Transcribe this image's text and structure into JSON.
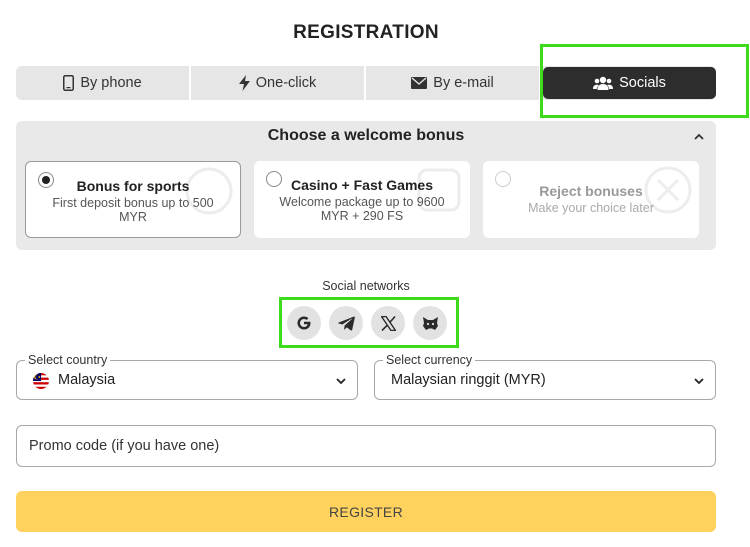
{
  "page": {
    "title": "REGISTRATION"
  },
  "tabs": [
    {
      "label": "By phone",
      "icon": "phone-icon",
      "active": false
    },
    {
      "label": "One-click",
      "icon": "lightning-icon",
      "active": false
    },
    {
      "label": "By e-mail",
      "icon": "envelope-icon",
      "active": false
    },
    {
      "label": "Socials",
      "icon": "users-icon",
      "active": true
    }
  ],
  "bonus": {
    "title": "Choose a welcome bonus",
    "options": [
      {
        "title": "Bonus for sports",
        "desc": "First deposit bonus up to 500 MYR",
        "selected": true
      },
      {
        "title": "Casino + Fast Games",
        "desc": "Welcome package up to 9600 MYR + 290 FS",
        "selected": false
      },
      {
        "title": "Reject bonuses",
        "desc": "Make your choice later",
        "selected": false
      }
    ]
  },
  "social": {
    "label": "Social networks",
    "networks": [
      "google-icon",
      "telegram-icon",
      "x-icon",
      "metamask-icon"
    ]
  },
  "country": {
    "label": "Select country",
    "value": "Malaysia"
  },
  "currency": {
    "label": "Select currency",
    "value": "Malaysian ringgit (MYR)"
  },
  "promo": {
    "placeholder": "Promo code (if you have one)"
  },
  "register": {
    "label": "REGISTER"
  },
  "colors": {
    "accent_button": "#ffd25e",
    "active_tab": "#2d2d2d",
    "highlight": "#3ddc1a"
  }
}
